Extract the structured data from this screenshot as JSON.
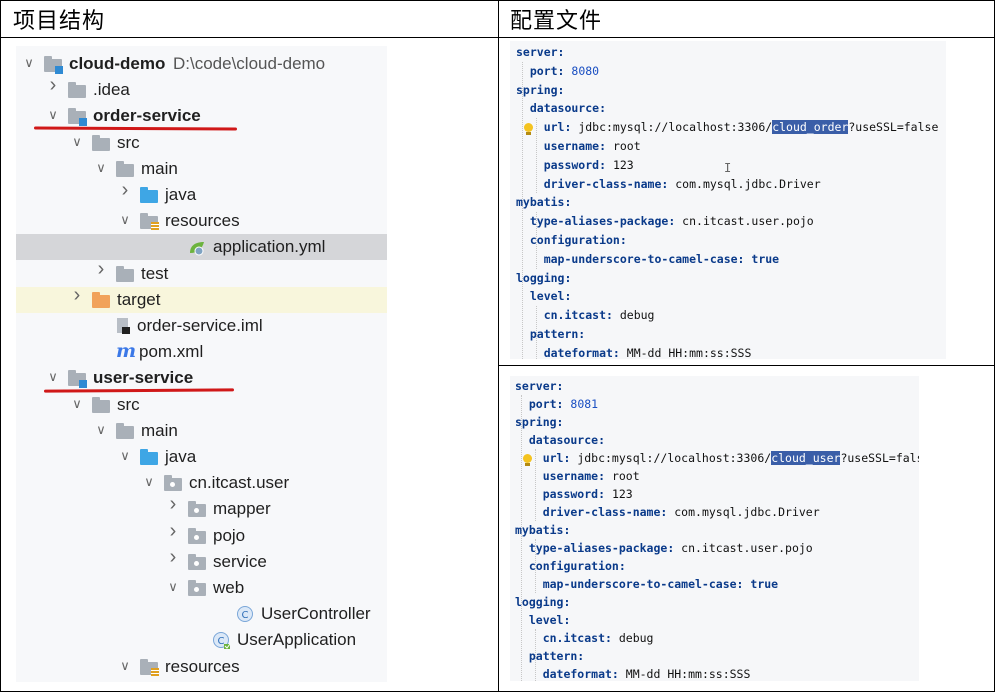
{
  "headers": {
    "left": "项目结构",
    "right": "配置文件"
  },
  "tree": [
    {
      "label": "cloud-demo",
      "path": "D:\\code\\cloud-demo",
      "type": "module",
      "bold": true,
      "indent": 0,
      "chev": "down"
    },
    {
      "label": ".idea",
      "type": "folder",
      "indent": 1,
      "chev": "right"
    },
    {
      "label": "order-service",
      "type": "module",
      "bold": true,
      "indent": 1,
      "chev": "down"
    },
    {
      "label": "src",
      "type": "folder",
      "indent": 2,
      "chev": "down"
    },
    {
      "label": "main",
      "type": "folder",
      "indent": 3,
      "chev": "down"
    },
    {
      "label": "java",
      "type": "folder-blue",
      "indent": 4,
      "chev": "right"
    },
    {
      "label": "resources",
      "type": "folder-res",
      "indent": 4,
      "chev": "down"
    },
    {
      "label": "application.yml",
      "type": "yml",
      "indent": 6,
      "chev": "",
      "selected": true
    },
    {
      "label": "test",
      "type": "folder",
      "indent": 3,
      "chev": "right"
    },
    {
      "label": "target",
      "type": "folder-orange",
      "indent": 2,
      "chev": "right",
      "highlight": true
    },
    {
      "label": "order-service.iml",
      "type": "iml",
      "indent": 3,
      "chev": ""
    },
    {
      "label": "pom.xml",
      "type": "maven",
      "indent": 3,
      "chev": ""
    },
    {
      "label": "user-service",
      "type": "module",
      "bold": true,
      "indent": 1,
      "chev": "down"
    },
    {
      "label": "src",
      "type": "folder",
      "indent": 2,
      "chev": "down"
    },
    {
      "label": "main",
      "type": "folder",
      "indent": 3,
      "chev": "down"
    },
    {
      "label": "java",
      "type": "folder-blue",
      "indent": 4,
      "chev": "down"
    },
    {
      "label": "cn.itcast.user",
      "type": "package",
      "indent": 5,
      "chev": "down"
    },
    {
      "label": "mapper",
      "type": "package",
      "indent": 6,
      "chev": "right"
    },
    {
      "label": "pojo",
      "type": "package",
      "indent": 6,
      "chev": "right"
    },
    {
      "label": "service",
      "type": "package",
      "indent": 6,
      "chev": "right"
    },
    {
      "label": "web",
      "type": "package",
      "indent": 6,
      "chev": "down"
    },
    {
      "label": "UserController",
      "type": "class",
      "indent": 8,
      "chev": ""
    },
    {
      "label": "UserApplication",
      "type": "class-app",
      "indent": 7,
      "chev": ""
    },
    {
      "label": "resources",
      "type": "folder-res",
      "indent": 4,
      "chev": "down"
    }
  ],
  "configs": [
    {
      "lines": [
        [
          {
            "t": "server:",
            "c": "k"
          }
        ],
        [
          {
            "t": "  port: ",
            "c": "k"
          },
          {
            "t": "8080",
            "c": "n"
          }
        ],
        [
          {
            "t": "spring:",
            "c": "k"
          }
        ],
        [
          {
            "t": "  datasource:",
            "c": "k"
          }
        ],
        [
          {
            "t": "    url: ",
            "c": "k"
          },
          {
            "t": "jdbc:mysql://localhost:3306/",
            "c": "v"
          },
          {
            "t": "cloud_order",
            "c": "hl"
          },
          {
            "t": "?useSSL=false",
            "c": "v"
          }
        ],
        [
          {
            "t": "    username: ",
            "c": "k"
          },
          {
            "t": "root",
            "c": "v"
          }
        ],
        [
          {
            "t": "    password: ",
            "c": "k"
          },
          {
            "t": "123",
            "c": "v"
          }
        ],
        [
          {
            "t": "    driver-class-name: ",
            "c": "k"
          },
          {
            "t": "com.mysql.jdbc.Driver",
            "c": "v"
          }
        ],
        [
          {
            "t": "mybatis:",
            "c": "k"
          }
        ],
        [
          {
            "t": "  type-aliases-package: ",
            "c": "k"
          },
          {
            "t": "cn.itcast.user.pojo",
            "c": "v"
          }
        ],
        [
          {
            "t": "  configuration:",
            "c": "k"
          }
        ],
        [
          {
            "t": "    map-underscore-to-camel-case: ",
            "c": "k"
          },
          {
            "t": "true",
            "c": "t"
          }
        ],
        [
          {
            "t": "logging:",
            "c": "k"
          }
        ],
        [
          {
            "t": "  level:",
            "c": "k"
          }
        ],
        [
          {
            "t": "    cn.itcast: ",
            "c": "k"
          },
          {
            "t": "debug",
            "c": "v"
          }
        ],
        [
          {
            "t": "  pattern:",
            "c": "k"
          }
        ],
        [
          {
            "t": "    dateformat: ",
            "c": "k"
          },
          {
            "t": "MM-dd HH:mm:ss:SSS",
            "c": "v"
          }
        ]
      ]
    },
    {
      "lines": [
        [
          {
            "t": "server:",
            "c": "k"
          }
        ],
        [
          {
            "t": "  port: ",
            "c": "k"
          },
          {
            "t": "8081",
            "c": "n"
          }
        ],
        [
          {
            "t": "spring:",
            "c": "k"
          }
        ],
        [
          {
            "t": "  datasource:",
            "c": "k"
          }
        ],
        [
          {
            "t": "    url: ",
            "c": "k"
          },
          {
            "t": "jdbc:mysql://localhost:3306/",
            "c": "v"
          },
          {
            "t": "cloud_user",
            "c": "hl"
          },
          {
            "t": "?useSSL=false",
            "c": "v"
          }
        ],
        [
          {
            "t": "    username: ",
            "c": "k"
          },
          {
            "t": "root",
            "c": "v"
          }
        ],
        [
          {
            "t": "    password: ",
            "c": "k"
          },
          {
            "t": "123",
            "c": "v"
          }
        ],
        [
          {
            "t": "    driver-class-name: ",
            "c": "k"
          },
          {
            "t": "com.mysql.jdbc.Driver",
            "c": "v"
          }
        ],
        [
          {
            "t": "mybatis:",
            "c": "k"
          }
        ],
        [
          {
            "t": "  type-aliases-package: ",
            "c": "k"
          },
          {
            "t": "cn.itcast.user.pojo",
            "c": "v"
          }
        ],
        [
          {
            "t": "  configuration:",
            "c": "k"
          }
        ],
        [
          {
            "t": "    map-underscore-to-camel-case: ",
            "c": "k"
          },
          {
            "t": "true",
            "c": "t"
          }
        ],
        [
          {
            "t": "logging:",
            "c": "k"
          }
        ],
        [
          {
            "t": "  level:",
            "c": "k"
          }
        ],
        [
          {
            "t": "    cn.itcast: ",
            "c": "k"
          },
          {
            "t": "debug",
            "c": "v"
          }
        ],
        [
          {
            "t": "  pattern:",
            "c": "k"
          }
        ],
        [
          {
            "t": "    dateformat: ",
            "c": "k"
          },
          {
            "t": "MM-dd HH:mm:ss:SSS",
            "c": "v"
          }
        ]
      ]
    }
  ]
}
